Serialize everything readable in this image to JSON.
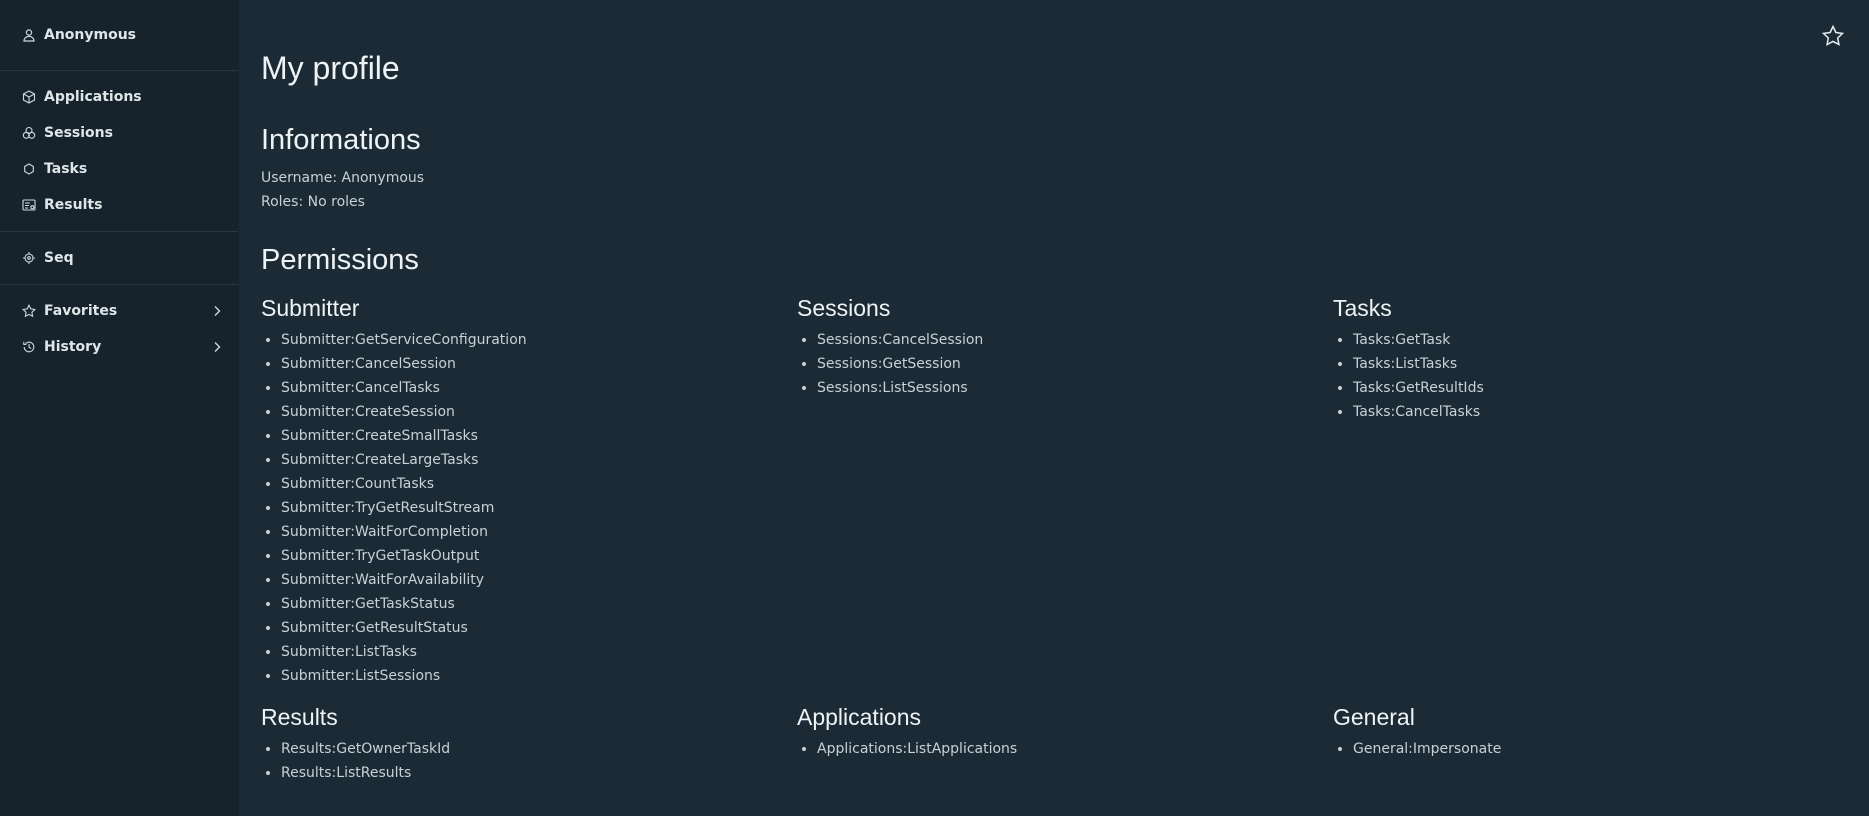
{
  "sidebar": {
    "user": {
      "label": "Anonymous",
      "icon": "user-icon"
    },
    "nav": [
      {
        "label": "Applications",
        "icon": "package-icon"
      },
      {
        "label": "Sessions",
        "icon": "circles-icon"
      },
      {
        "label": "Tasks",
        "icon": "hexagon-icon"
      },
      {
        "label": "Results",
        "icon": "results-icon"
      }
    ],
    "seq": {
      "label": "Seq",
      "icon": "target-icon"
    },
    "favorites": {
      "label": "Favorites",
      "icon": "star-icon"
    },
    "history": {
      "label": "History",
      "icon": "history-icon"
    }
  },
  "page": {
    "title": "My profile",
    "info_title": "Informations",
    "username_line": "Username: Anonymous",
    "roles_line": "Roles: No roles",
    "permissions_title": "Permissions"
  },
  "permissions": [
    {
      "name": "Submitter",
      "items": [
        "Submitter:GetServiceConfiguration",
        "Submitter:CancelSession",
        "Submitter:CancelTasks",
        "Submitter:CreateSession",
        "Submitter:CreateSmallTasks",
        "Submitter:CreateLargeTasks",
        "Submitter:CountTasks",
        "Submitter:TryGetResultStream",
        "Submitter:WaitForCompletion",
        "Submitter:TryGetTaskOutput",
        "Submitter:WaitForAvailability",
        "Submitter:GetTaskStatus",
        "Submitter:GetResultStatus",
        "Submitter:ListTasks",
        "Submitter:ListSessions"
      ]
    },
    {
      "name": "Sessions",
      "items": [
        "Sessions:CancelSession",
        "Sessions:GetSession",
        "Sessions:ListSessions"
      ]
    },
    {
      "name": "Tasks",
      "items": [
        "Tasks:GetTask",
        "Tasks:ListTasks",
        "Tasks:GetResultIds",
        "Tasks:CancelTasks"
      ]
    },
    {
      "name": "Results",
      "items": [
        "Results:GetOwnerTaskId",
        "Results:ListResults"
      ]
    },
    {
      "name": "Applications",
      "items": [
        "Applications:ListApplications"
      ]
    },
    {
      "name": "General",
      "items": [
        "General:Impersonate"
      ]
    }
  ]
}
